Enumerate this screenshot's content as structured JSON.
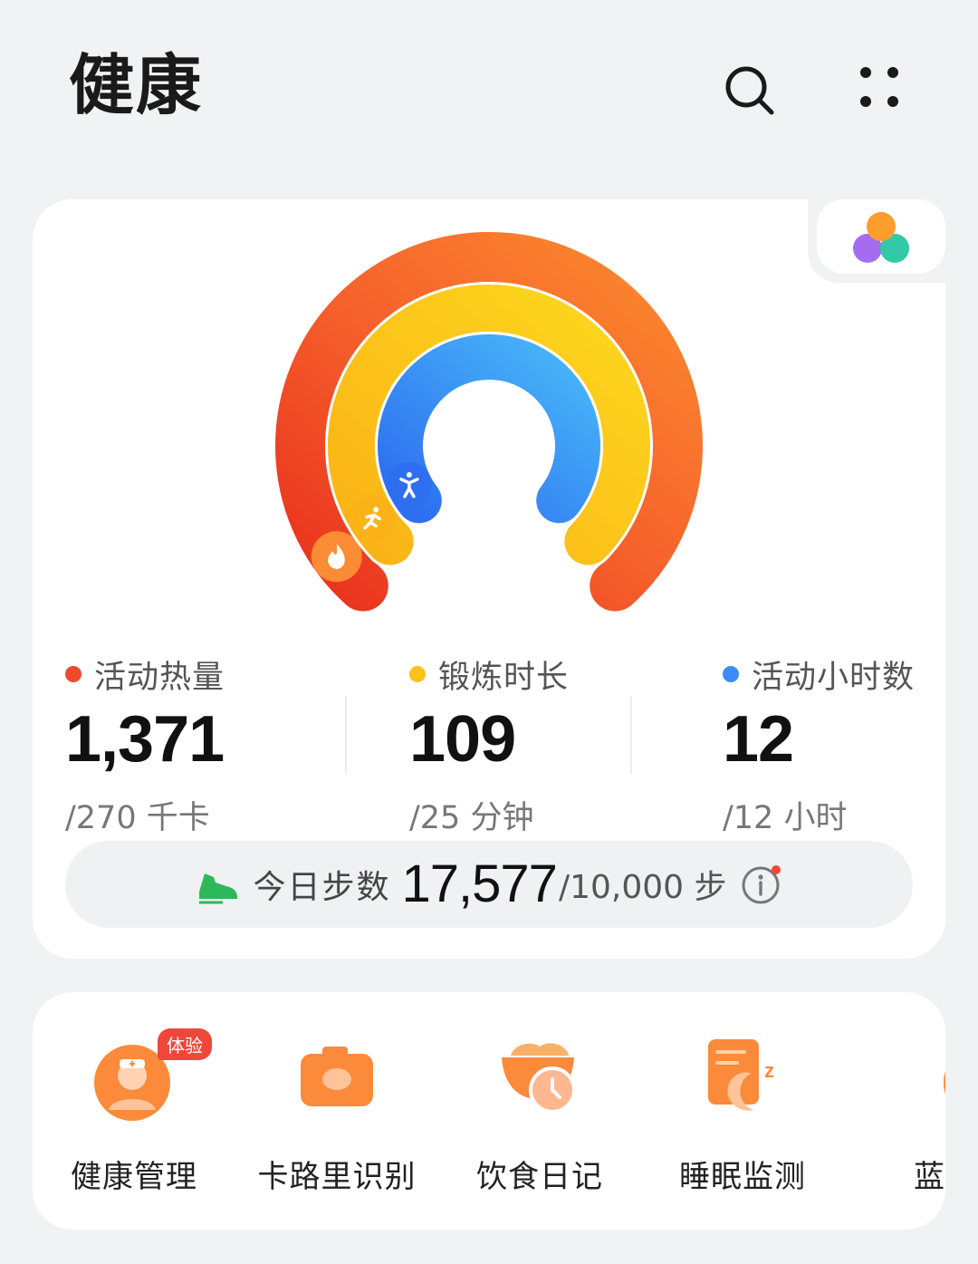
{
  "app": {
    "title": "健康"
  },
  "header": {
    "search_icon": "search-icon",
    "more_icon": "four-dots-menu-icon"
  },
  "activity": {
    "rings": [
      {
        "name": "活动热量",
        "color": "#f04a2c",
        "progress": 5.08,
        "icon": "flame-icon"
      },
      {
        "name": "锻炼时长",
        "color": "#fbc21a",
        "progress": 4.36,
        "icon": "running-icon"
      },
      {
        "name": "活动小时数",
        "color": "#3d8cf5",
        "progress": 1.0,
        "icon": "standing-person-icon"
      }
    ],
    "metrics": [
      {
        "label": "活动热量",
        "value": "1,371",
        "target": "/270 千卡",
        "color": "#f04a2c"
      },
      {
        "label": "锻炼时长",
        "value": "109",
        "target": "/25 分钟",
        "color": "#fbc21a"
      },
      {
        "label": "活动小时数",
        "value": "12",
        "target": "/12 小时",
        "color": "#3d8cf5"
      }
    ],
    "steps": {
      "label": "今日步数",
      "value": "17,577",
      "target": "/10,000 步",
      "icon": "shoe-icon",
      "info_icon": "info-icon"
    }
  },
  "services": [
    {
      "label": "健康管理",
      "badge": "体验",
      "icon": "doctor-icon"
    },
    {
      "label": "卡路里识别",
      "icon": "camera-icon"
    },
    {
      "label": "饮食日记",
      "icon": "food-bowl-clock-icon"
    },
    {
      "label": "睡眠监测",
      "icon": "sleep-moon-icon"
    },
    {
      "label": "蓝星",
      "icon": "location-pin-icon"
    }
  ],
  "colors": {
    "accent_green": "#2fb85a",
    "badge_red": "#f0473b",
    "service_orange": "#fb8a3a"
  }
}
